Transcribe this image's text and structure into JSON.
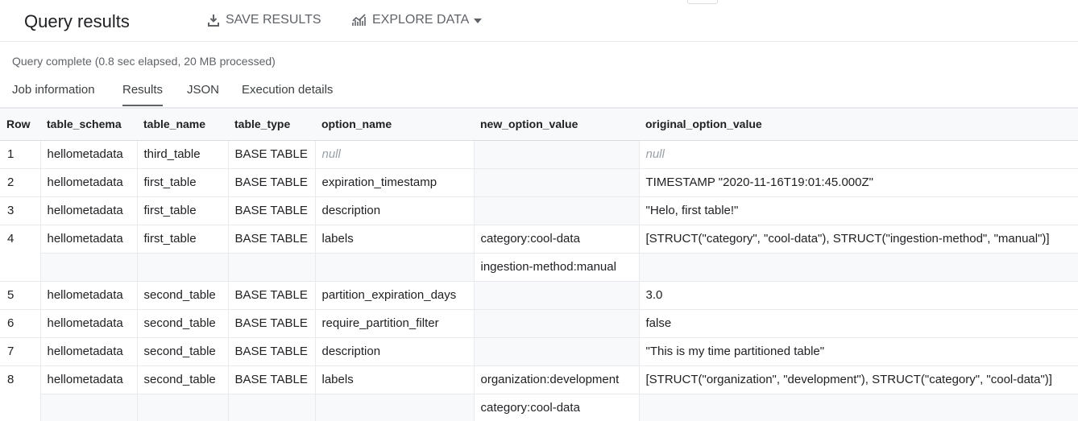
{
  "header": {
    "title": "Query results",
    "save_label": "SAVE RESULTS",
    "explore_label": "EXPLORE DATA"
  },
  "status": "Query complete (0.8 sec elapsed, 20 MB processed)",
  "tabs": [
    {
      "label": "Job information",
      "active": false
    },
    {
      "label": "Results",
      "active": true
    },
    {
      "label": "JSON",
      "active": false
    },
    {
      "label": "Execution details",
      "active": false
    }
  ],
  "table": {
    "columns": [
      "Row",
      "table_schema",
      "table_name",
      "table_type",
      "option_name",
      "new_option_value",
      "original_option_value"
    ],
    "rows": [
      {
        "row": "1",
        "table_schema": "hellometadata",
        "table_name": "third_table",
        "table_type": "BASE TABLE",
        "option_name": "null",
        "new_option_value": [
          ""
        ],
        "original_option_value": "null",
        "is_null": true
      },
      {
        "row": "2",
        "table_schema": "hellometadata",
        "table_name": "first_table",
        "table_type": "BASE TABLE",
        "option_name": "expiration_timestamp",
        "new_option_value": [
          ""
        ],
        "original_option_value": "TIMESTAMP \"2020-11-16T19:01:45.000Z\""
      },
      {
        "row": "3",
        "table_schema": "hellometadata",
        "table_name": "first_table",
        "table_type": "BASE TABLE",
        "option_name": "description",
        "new_option_value": [
          ""
        ],
        "original_option_value": "\"Helo, first table!\""
      },
      {
        "row": "4",
        "table_schema": "hellometadata",
        "table_name": "first_table",
        "table_type": "BASE TABLE",
        "option_name": "labels",
        "new_option_value": [
          "category:cool-data",
          "ingestion-method:manual"
        ],
        "original_option_value": "[STRUCT(\"category\", \"cool-data\"), STRUCT(\"ingestion-method\", \"manual\")]"
      },
      {
        "row": "5",
        "table_schema": "hellometadata",
        "table_name": "second_table",
        "table_type": "BASE TABLE",
        "option_name": "partition_expiration_days",
        "new_option_value": [
          ""
        ],
        "original_option_value": "3.0"
      },
      {
        "row": "6",
        "table_schema": "hellometadata",
        "table_name": "second_table",
        "table_type": "BASE TABLE",
        "option_name": "require_partition_filter",
        "new_option_value": [
          ""
        ],
        "original_option_value": "false"
      },
      {
        "row": "7",
        "table_schema": "hellometadata",
        "table_name": "second_table",
        "table_type": "BASE TABLE",
        "option_name": "description",
        "new_option_value": [
          ""
        ],
        "original_option_value": "\"This is my time partitioned table\""
      },
      {
        "row": "8",
        "table_schema": "hellometadata",
        "table_name": "second_table",
        "table_type": "BASE TABLE",
        "option_name": "labels",
        "new_option_value": [
          "organization:development",
          "category:cool-data"
        ],
        "original_option_value": "[STRUCT(\"organization\", \"development\"), STRUCT(\"category\", \"cool-data\")]"
      }
    ]
  },
  "icons": {
    "save": "download-icon",
    "explore": "chart-icon",
    "caret": "caret-down-icon"
  },
  "colors": {
    "text": "#202124",
    "muted": "#5f6368",
    "header_bg": "#f8f9fa",
    "border": "#e8eaed"
  }
}
